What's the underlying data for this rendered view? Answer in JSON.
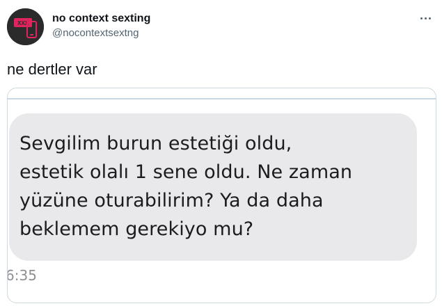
{
  "account": {
    "display_name": "no context sexting",
    "handle": "@nocontextsextng",
    "avatar_text": "XXX"
  },
  "tweet": {
    "text": "ne dertler var"
  },
  "media": {
    "message_lines": [
      "Sevgilim burun estetiği oldu,",
      "estetik olalı 1 sene oldu. Ne zaman",
      "yüzüne oturabilirim? Ya da daha",
      "beklemem gerekiyo mu?"
    ],
    "timestamp": "6:35"
  },
  "colors": {
    "avatar_bg": "#2b2b2b",
    "avatar_accent": "#e0245e",
    "bubble_bg": "#e9e9eb",
    "secondary_text": "#536471"
  }
}
